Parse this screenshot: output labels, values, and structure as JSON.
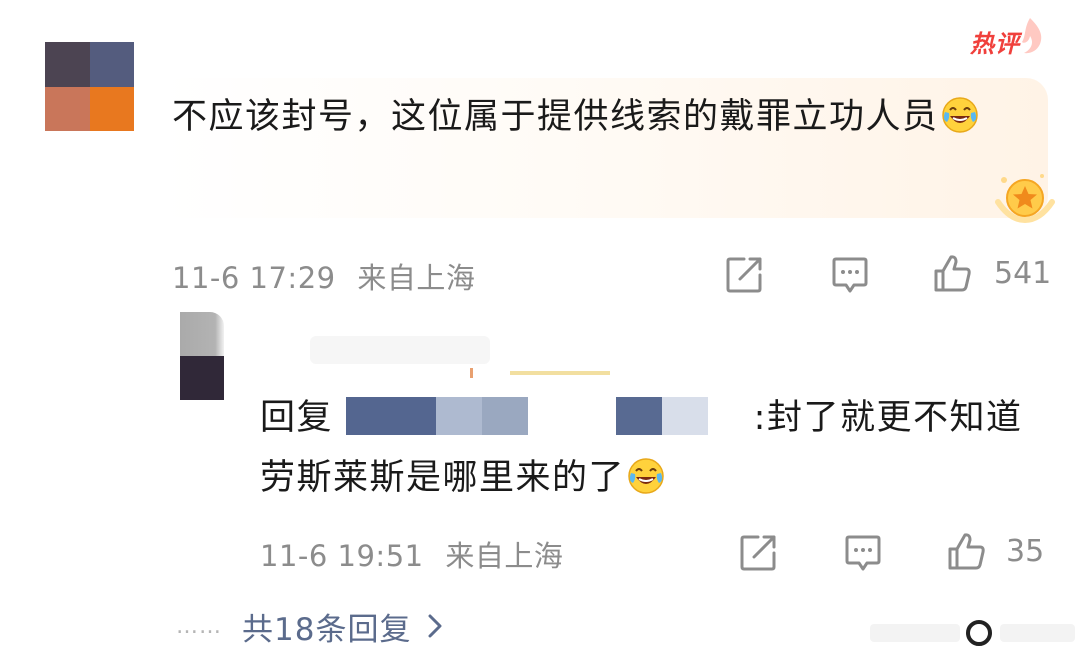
{
  "main_comment": {
    "hot_label": "热评",
    "text": "不应该封号，这位属于提供线索的戴罪立功人员",
    "emoji": "laugh-cry-emoji",
    "time": "11-6 17:29",
    "location": "来自上海",
    "like_count": "541"
  },
  "reply": {
    "prefix": "回复",
    "text_after_mention": ":封了就更不知道劳斯莱斯是哪里来的了",
    "emoji": "laugh-cry-emoji",
    "time": "11-6 19:51",
    "location": "来自上海",
    "like_count": "35"
  },
  "more_replies": {
    "dots": "……",
    "label": "共18条回复"
  },
  "colors": {
    "text": "#1a1a1a",
    "meta": "#8c8c8c",
    "link": "#5b6b8c",
    "hot": "#f0403c",
    "hot_card_bg": "#fff3e6"
  }
}
